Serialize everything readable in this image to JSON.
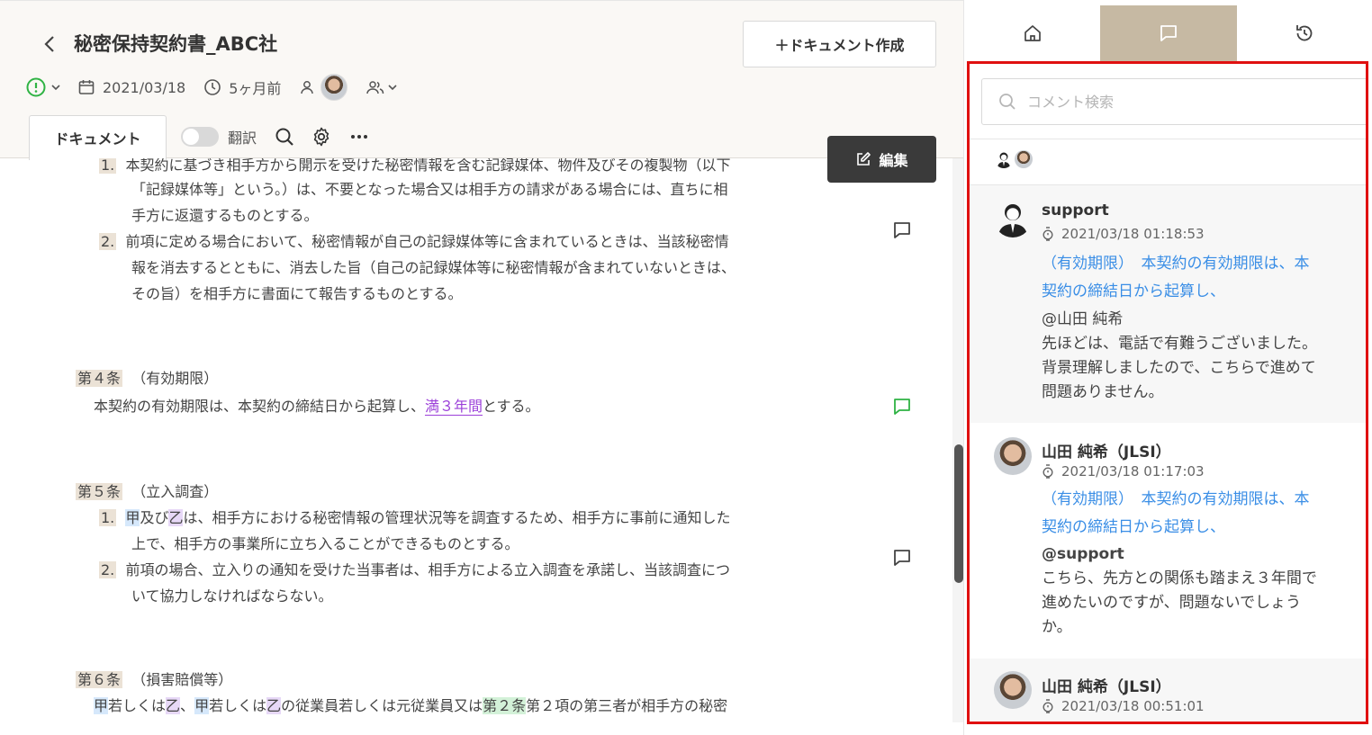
{
  "header": {
    "title": "秘密保持契約書_ABC社",
    "new_doc_label": "＋ドキュメント作成",
    "date": "2021/03/18",
    "relative_time": "5ヶ月前",
    "tab_label": "ドキュメント",
    "translate_label": "翻訳",
    "edit_label": "編集"
  },
  "document": {
    "sec3_item1_num": "1.",
    "sec3_item1_l1": "本契約に基づき相手方から開示を受けた秘密情報を含む記録媒体、物件及びその複製物（以下",
    "sec3_item1_l2": "「記録媒体等」という。）は、不要となった場合又は相手方の請求がある場合には、直ちに相",
    "sec3_item1_l3": "手方に返還するものとする。",
    "sec3_item2_num": "2.",
    "sec3_item2_l1": "前項に定める場合において、秘密情報が自己の記録媒体等に含まれているときは、当該秘密情",
    "sec3_item2_l2": "報を消去するとともに、消去した旨（自己の記録媒体等に秘密情報が含まれていないときは、",
    "sec3_item2_l3": "その旨）を相手方に書面にて報告するものとする。",
    "sec4_num": "第４条",
    "sec4_title": "（有効期限）",
    "sec4_l1_a": "本契約の有効期限は、本契約の締結日から起算し、",
    "sec4_l1_link": "満３年間",
    "sec4_l1_b": "とする。",
    "sec5_num": "第５条",
    "sec5_title": "（立入調査）",
    "sec5_item1_num": "1.",
    "sec5_item1_hl1": "甲",
    "sec5_item1_a": "及び",
    "sec5_item1_hl2": "乙",
    "sec5_item1_b": "は、相手方における秘密情報の管理状況等を調査するため、相手方に事前に通知した",
    "sec5_item1_l2": "上で、相手方の事業所に立ち入ることができるものとする。",
    "sec5_item2_num": "2.",
    "sec5_item2_l1": "前項の場合、立入りの通知を受けた当事者は、相手方による立入調査を承諾し、当該調査につ",
    "sec5_item2_l2": "いて協力しなければならない。",
    "sec6_num": "第６条",
    "sec6_title": "（損害賠償等）",
    "sec6_hl1": "甲",
    "sec6_a": "若しくは",
    "sec6_hl2": "乙",
    "sec6_b": "、",
    "sec6_hl3": "甲",
    "sec6_c": "若しくは",
    "sec6_hl4": "乙",
    "sec6_d": "の従業員若しくは元従業員又は",
    "sec6_hl5": "第２条",
    "sec6_e": "第２項の第三者が相手方の秘密"
  },
  "sidebar": {
    "search_placeholder": "コメント検索",
    "comments": [
      {
        "author": "support",
        "time": "2021/03/18 01:18:53",
        "quote_l1": "（有効期限）　本契約の有効期限は、本",
        "quote_l2": "契約の締結日から起算し、",
        "mention": "@山田 純希",
        "body_l1": "先ほどは、電話で有難うございました。",
        "body_l2": "背景理解しましたので、こちらで進めて",
        "body_l3": "問題ありません。"
      },
      {
        "author": "山田 純希（JLSI）",
        "time": "2021/03/18 01:17:03",
        "quote_l1": "（有効期限）　本契約の有効期限は、本",
        "quote_l2": "契約の締結日から起算し、",
        "mention": "@support",
        "body_l1": "こちら、先方との関係も踏まえ３年間で",
        "body_l2": "進めたいのですが、問題ないでしょう",
        "body_l3": "か。"
      },
      {
        "author": "山田 純希（JLSI）",
        "time": "2021/03/18 00:51:01"
      }
    ]
  },
  "colors": {
    "accent_tab": "#c6b9a3",
    "highlight_box": "#e01010",
    "quote_blue": "#3a8ee6",
    "status_green": "#2fb344"
  }
}
